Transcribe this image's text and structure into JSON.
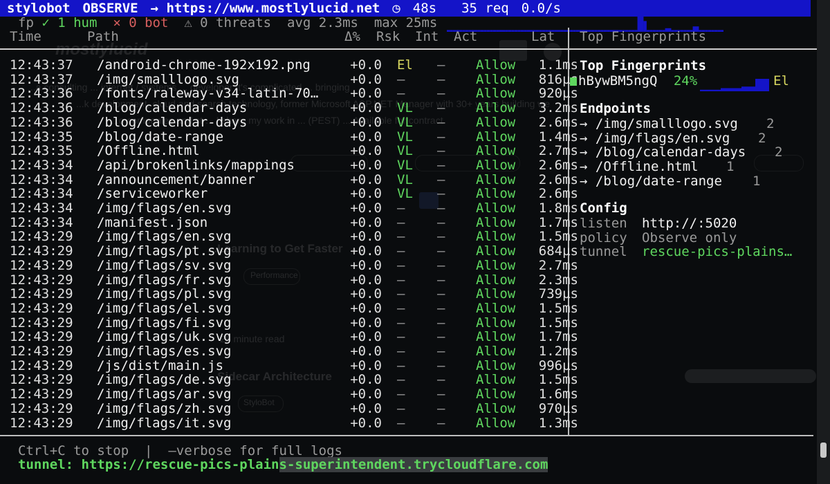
{
  "topbar": {
    "app": "stylobot",
    "mode": "OBSERVE",
    "url": "→ https://www.mostlylucid.net",
    "uptime": "48s",
    "requests": "35 req",
    "rate": "0.0/s",
    "uptime_icon": "clock-icon"
  },
  "stats": {
    "fp_label": "fp",
    "human": "✓ 1 hum",
    "bot": "× 0 bot",
    "threats": "⚠ 0 threats",
    "avg": "avg 2.3ms",
    "max": "max 25ms",
    "spark_values": [
      2,
      2,
      2,
      2,
      2,
      2,
      2,
      2,
      2,
      2,
      2,
      2,
      2,
      2,
      2,
      2,
      2,
      2,
      2,
      2,
      2,
      2,
      2,
      2,
      2,
      2,
      2,
      2,
      2,
      2,
      2,
      2,
      2,
      2,
      2,
      2,
      2,
      2,
      2,
      2,
      2,
      2,
      2,
      2,
      2,
      2,
      2,
      2,
      2,
      2,
      2,
      2,
      2,
      2,
      2,
      2,
      2,
      2,
      2,
      2,
      2,
      2,
      20,
      20,
      12,
      2,
      2,
      2,
      2,
      2,
      2,
      4,
      4,
      2,
      2,
      2,
      2,
      2,
      2,
      2,
      6,
      6,
      2,
      2,
      2,
      2,
      2,
      2,
      2,
      2
    ]
  },
  "columns": {
    "time": "Time",
    "path": "Path",
    "delta": "Δ%",
    "risk": "Rsk",
    "intent": "Int",
    "action": "Act",
    "latency": "Lat"
  },
  "rows": [
    {
      "time": "12:43:37",
      "path": "/android-chrome-192x192.png",
      "delta": "+0.0",
      "risk": "El",
      "intent": "–",
      "action": "Allow",
      "latency": "1.1ms"
    },
    {
      "time": "12:43:37",
      "path": "/img/smalllogo.svg",
      "delta": "+0.0",
      "risk": "–",
      "intent": "–",
      "action": "Allow",
      "latency": "816µs"
    },
    {
      "time": "12:43:36",
      "path": "/fonts/raleway-v34-latin-70…",
      "delta": "+0.0",
      "risk": "–",
      "intent": "–",
      "action": "Allow",
      "latency": "920µs"
    },
    {
      "time": "12:43:36",
      "path": "/blog/calendar-days",
      "delta": "+0.0",
      "risk": "VL",
      "intent": "–",
      "action": "Allow",
      "latency": "3.2ms"
    },
    {
      "time": "12:43:36",
      "path": "/blog/calendar-days",
      "delta": "+0.0",
      "risk": "VL",
      "intent": "–",
      "action": "Allow",
      "latency": "2.6ms"
    },
    {
      "time": "12:43:35",
      "path": "/blog/date-range",
      "delta": "+0.0",
      "risk": "VL",
      "intent": "–",
      "action": "Allow",
      "latency": "1.4ms"
    },
    {
      "time": "12:43:35",
      "path": "/Offline.html",
      "delta": "+0.0",
      "risk": "VL",
      "intent": "–",
      "action": "Allow",
      "latency": "2.7ms"
    },
    {
      "time": "12:43:34",
      "path": "/api/brokenlinks/mappings",
      "delta": "+0.0",
      "risk": "VL",
      "intent": "–",
      "action": "Allow",
      "latency": "2.6ms"
    },
    {
      "time": "12:43:34",
      "path": "/announcement/banner",
      "delta": "+0.0",
      "risk": "VL",
      "intent": "–",
      "action": "Allow",
      "latency": "2.6ms"
    },
    {
      "time": "12:43:34",
      "path": "/serviceworker",
      "delta": "+0.0",
      "risk": "VL",
      "intent": "–",
      "action": "Allow",
      "latency": "2.6ms"
    },
    {
      "time": "12:43:34",
      "path": "/img/flags/en.svg",
      "delta": "+0.0",
      "risk": "–",
      "intent": "–",
      "action": "Allow",
      "latency": "1.8ms"
    },
    {
      "time": "12:43:34",
      "path": "/manifest.json",
      "delta": "+0.0",
      "risk": "–",
      "intent": "–",
      "action": "Allow",
      "latency": "1.7ms"
    },
    {
      "time": "12:43:29",
      "path": "/img/flags/en.svg",
      "delta": "+0.0",
      "risk": "–",
      "intent": "–",
      "action": "Allow",
      "latency": "1.5ms"
    },
    {
      "time": "12:43:29",
      "path": "/img/flags/pt.svg",
      "delta": "+0.0",
      "risk": "–",
      "intent": "–",
      "action": "Allow",
      "latency": "684µs"
    },
    {
      "time": "12:43:29",
      "path": "/img/flags/sv.svg",
      "delta": "+0.0",
      "risk": "–",
      "intent": "–",
      "action": "Allow",
      "latency": "2.7ms"
    },
    {
      "time": "12:43:29",
      "path": "/img/flags/fr.svg",
      "delta": "+0.0",
      "risk": "–",
      "intent": "–",
      "action": "Allow",
      "latency": "2.3ms"
    },
    {
      "time": "12:43:29",
      "path": "/img/flags/pl.svg",
      "delta": "+0.0",
      "risk": "–",
      "intent": "–",
      "action": "Allow",
      "latency": "739µs"
    },
    {
      "time": "12:43:29",
      "path": "/img/flags/el.svg",
      "delta": "+0.0",
      "risk": "–",
      "intent": "–",
      "action": "Allow",
      "latency": "1.5ms"
    },
    {
      "time": "12:43:29",
      "path": "/img/flags/fi.svg",
      "delta": "+0.0",
      "risk": "–",
      "intent": "–",
      "action": "Allow",
      "latency": "1.5ms"
    },
    {
      "time": "12:43:29",
      "path": "/img/flags/uk.svg",
      "delta": "+0.0",
      "risk": "–",
      "intent": "–",
      "action": "Allow",
      "latency": "1.7ms"
    },
    {
      "time": "12:43:29",
      "path": "/img/flags/es.svg",
      "delta": "+0.0",
      "risk": "–",
      "intent": "–",
      "action": "Allow",
      "latency": "1.2ms"
    },
    {
      "time": "12:43:29",
      "path": "/js/dist/main.js",
      "delta": "+0.0",
      "risk": "–",
      "intent": "–",
      "action": "Allow",
      "latency": "996µs"
    },
    {
      "time": "12:43:29",
      "path": "/img/flags/de.svg",
      "delta": "+0.0",
      "risk": "–",
      "intent": "–",
      "action": "Allow",
      "latency": "1.5ms"
    },
    {
      "time": "12:43:29",
      "path": "/img/flags/ar.svg",
      "delta": "+0.0",
      "risk": "–",
      "intent": "–",
      "action": "Allow",
      "latency": "1.6ms"
    },
    {
      "time": "12:43:29",
      "path": "/img/flags/zh.svg",
      "delta": "+0.0",
      "risk": "–",
      "intent": "–",
      "action": "Allow",
      "latency": "970µs"
    },
    {
      "time": "12:43:29",
      "path": "/img/flags/it.svg",
      "delta": "+0.0",
      "risk": "–",
      "intent": "–",
      "action": "Allow",
      "latency": "1.3ms"
    }
  ],
  "sidebar": {
    "ghost_title": "Top Fingerprints",
    "fingerprints_title": "Top Fingerprints",
    "fingerprint": {
      "id": "hBywBM5ngQ",
      "pct": "24%",
      "risk": "El",
      "spark_values": [
        1,
        1,
        1,
        2,
        2,
        2,
        3,
        3,
        8,
        8
      ]
    },
    "endpoints_title": "Endpoints",
    "endpoints": [
      {
        "path": "→ /img/smalllogo.svg",
        "count": "2"
      },
      {
        "path": "→ /img/flags/en.svg",
        "count": "2"
      },
      {
        "path": "→ /blog/calendar-days",
        "count": "2"
      },
      {
        "path": "→ /Offline.html",
        "count": "1"
      },
      {
        "path": "→ /blog/date-range",
        "count": "1"
      }
    ],
    "config_title": "Config",
    "config": [
      {
        "key": "listen",
        "value": "http://:5020"
      },
      {
        "key": "policy",
        "value": "Observe only"
      },
      {
        "key": "tunnel",
        "value": "rescue-pics-plains…"
      }
    ]
  },
  "footer": {
    "hint": "Ctrl+C to stop  |  —verbose for full logs",
    "tunnel_label": "tunnel: https://rescue-pics-plain",
    "tunnel_rest": "s-superintendent.trycloudflare.com"
  },
  "colors": {
    "accent_blue": "#1414c8",
    "allow_green": "#5fd75f",
    "risk_yellow": "#d7d75f",
    "bot_red": "#d75f5f"
  },
  "ghost_site": {
    "brand": "mostlylucid",
    "line1": "...a consulting ... internet / systems ... developer It's complicated ... bringing",
    "line2": "...k development, cloud and search technology, former Microsoft ASP.NET Manager with 30+ years building we",
    "line3": "...o companies and st ... I share my work in ... (PEST) ... Available for contract",
    "post1": "...Learning to Get Faster",
    "post2": "...Sidecar Architecture",
    "read": "25 minute read",
    "tag1": "Performance",
    "tag2": "StyloBot"
  }
}
